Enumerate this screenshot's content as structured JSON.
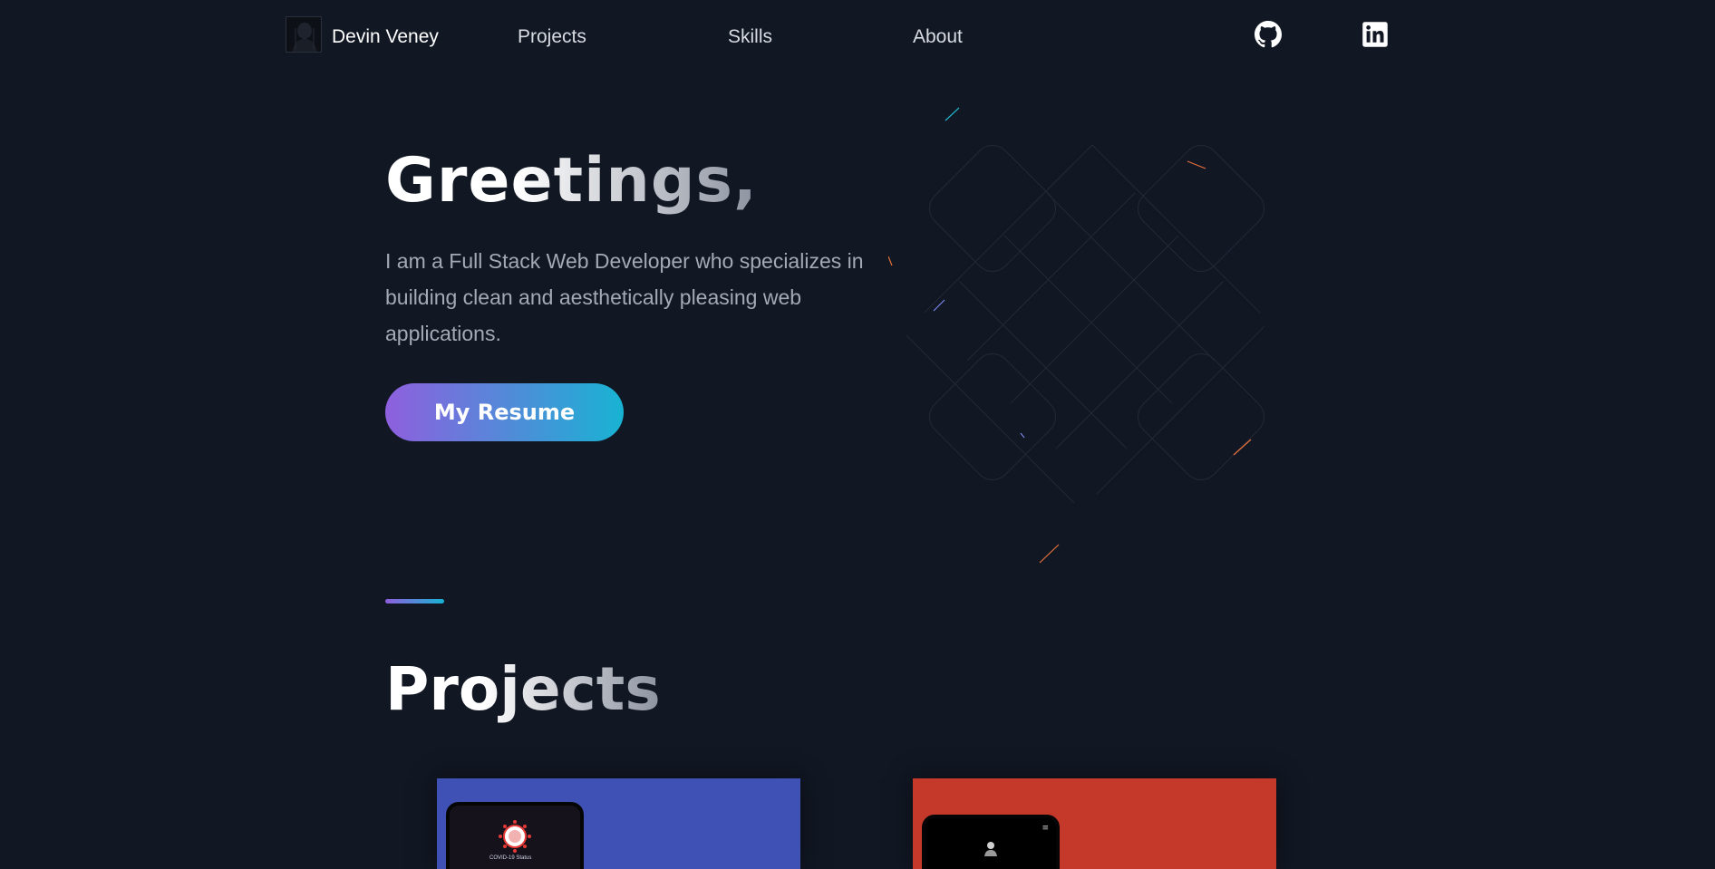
{
  "nav": {
    "brand": "Devin Veney",
    "links": [
      "Projects",
      "Skills",
      "About"
    ],
    "social": [
      "github-icon",
      "linkedin-icon"
    ]
  },
  "hero": {
    "title": "Greetings,",
    "description": "I am a Full Stack Web Developer who specializes in building clean and aesthetically pleasing web applications.",
    "button_label": "My Resume"
  },
  "projects": {
    "title": "Projects",
    "cards": [
      {
        "screen_text": "COVID-19 Status",
        "color": "#3f51b5"
      },
      {
        "color": "#c5392b"
      }
    ]
  },
  "colors": {
    "background": "#111723",
    "gradient_start": "#8f5fde",
    "gradient_end": "#18b3d3"
  }
}
